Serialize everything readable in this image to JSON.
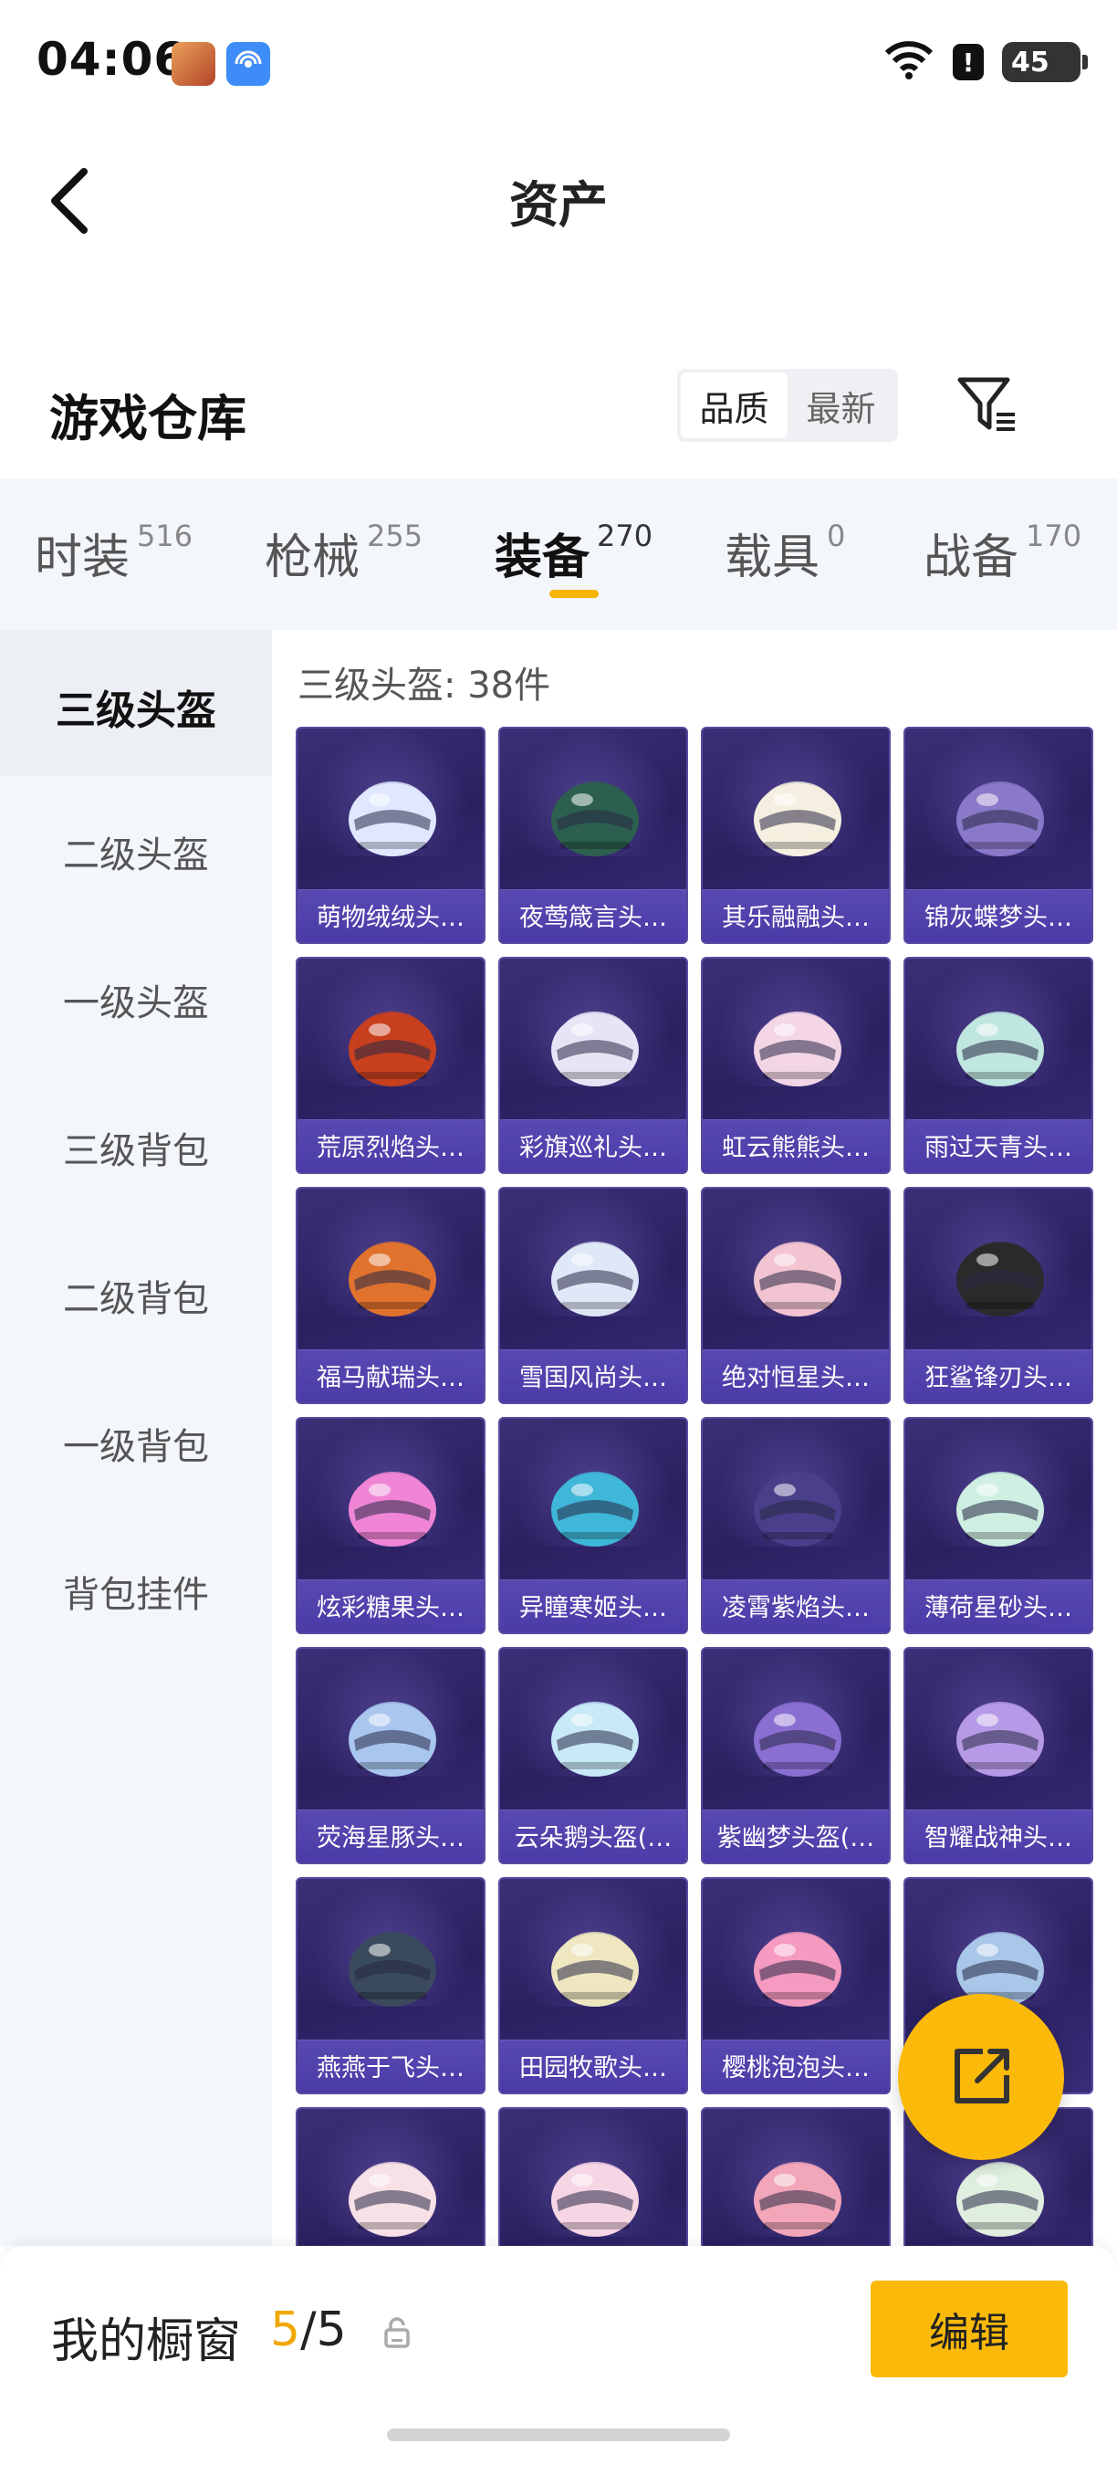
{
  "status_bar": {
    "time": "04:06",
    "battery": "45",
    "alert": "!"
  },
  "header": {
    "title": "资产"
  },
  "warehouse": {
    "title": "游戏仓库",
    "sort_options": [
      "品质",
      "最新"
    ],
    "sort_active": "品质"
  },
  "tabs": [
    {
      "label": "时装",
      "count": "516"
    },
    {
      "label": "枪械",
      "count": "255"
    },
    {
      "label": "装备",
      "count": "270"
    },
    {
      "label": "载具",
      "count": "0"
    },
    {
      "label": "战备",
      "count": "170"
    }
  ],
  "active_tab": "装备",
  "sidebar": {
    "items": [
      "三级头盔",
      "二级头盔",
      "一级头盔",
      "三级背包",
      "二级背包",
      "一级背包",
      "背包挂件"
    ],
    "active": "三级头盔"
  },
  "content": {
    "section_title": "三级头盔: 38件",
    "items": [
      {
        "name": "萌物绒绒头…",
        "icon": "fluffy-white-helmet-icon",
        "color": "#dfe8ff"
      },
      {
        "name": "夜莺箴言头…",
        "icon": "nightingale-helmet-icon",
        "color": "#2d5f4f"
      },
      {
        "name": "其乐融融头…",
        "icon": "cream-yellow-helmet-icon",
        "color": "#f5efe0"
      },
      {
        "name": "锦灰蝶梦头…",
        "icon": "butterfly-dream-helmet-icon",
        "color": "#8a78c8"
      },
      {
        "name": "荒原烈焰头…",
        "icon": "flame-helmet-icon",
        "color": "#c8401e"
      },
      {
        "name": "彩旗巡礼头…",
        "icon": "parade-helmet-icon",
        "color": "#e9e4f5"
      },
      {
        "name": "虹云熊熊头…",
        "icon": "rainbow-bear-helmet-icon",
        "color": "#f3d6e6"
      },
      {
        "name": "雨过天青头…",
        "icon": "celadon-helmet-icon",
        "color": "#bfe6df"
      },
      {
        "name": "福马献瑞头…",
        "icon": "fortune-horse-helmet-icon",
        "color": "#e0722e"
      },
      {
        "name": "雪国风尚头…",
        "icon": "snow-fashion-helmet-icon",
        "color": "#dfe7f7"
      },
      {
        "name": "绝对恒星头…",
        "icon": "absolute-star-helmet-icon",
        "color": "#f2c3d0"
      },
      {
        "name": "狂鲨锋刃头…",
        "icon": "shark-blade-helmet-icon",
        "color": "#2a2a2a"
      },
      {
        "name": "炫彩糖果头…",
        "icon": "candy-helmet-icon",
        "color": "#f085d6"
      },
      {
        "name": "异瞳寒姬头…",
        "icon": "frost-princess-helmet-icon",
        "color": "#3fb7d8"
      },
      {
        "name": "凌霄紫焰头…",
        "icon": "purple-flame-helmet-icon",
        "color": "#4a3f8a"
      },
      {
        "name": "薄荷星砂头…",
        "icon": "mint-stardust-helmet-icon",
        "color": "#cfeee2"
      },
      {
        "name": "荧海星豚头…",
        "icon": "dolphin-helmet-icon",
        "color": "#a9c6ef"
      },
      {
        "name": "云朵鹅头盔(…",
        "icon": "cloud-goose-helmet-icon",
        "color": "#c8e9f7"
      },
      {
        "name": "紫幽梦头盔(…",
        "icon": "violet-dream-helmet-icon",
        "color": "#8a6fd2"
      },
      {
        "name": "智耀战神头…",
        "icon": "war-god-helmet-icon",
        "color": "#b69ae6"
      },
      {
        "name": "燕燕于飞头…",
        "icon": "swallow-helmet-icon",
        "color": "#3a4a5c"
      },
      {
        "name": "田园牧歌头…",
        "icon": "pastoral-helmet-icon",
        "color": "#eee6c0"
      },
      {
        "name": "樱桃泡泡头…",
        "icon": "cherry-bubble-helmet-icon",
        "color": "#f59ac0"
      },
      {
        "name": "",
        "icon": "blue-goggle-helmet-icon",
        "color": "#a9c7e8"
      },
      {
        "name": "",
        "icon": "heart-helmet-icon",
        "color": "#f7e0e6"
      },
      {
        "name": "",
        "icon": "bunny-pink-helmet-icon",
        "color": "#f6d5e4"
      },
      {
        "name": "",
        "icon": "pink-visor-helmet-icon",
        "color": "#f2a6b8"
      },
      {
        "name": "",
        "icon": "pearl-helmet-icon",
        "color": "#dfeedf"
      }
    ]
  },
  "bottom_bar": {
    "showcase_label": "我的橱窗",
    "current": "5",
    "separator": "/",
    "total": "5",
    "edit_label": "编辑"
  },
  "colors": {
    "accent": "#fbb90a",
    "card_bg": "#2f2468",
    "sidebar_bg": "#f3f6fa"
  }
}
